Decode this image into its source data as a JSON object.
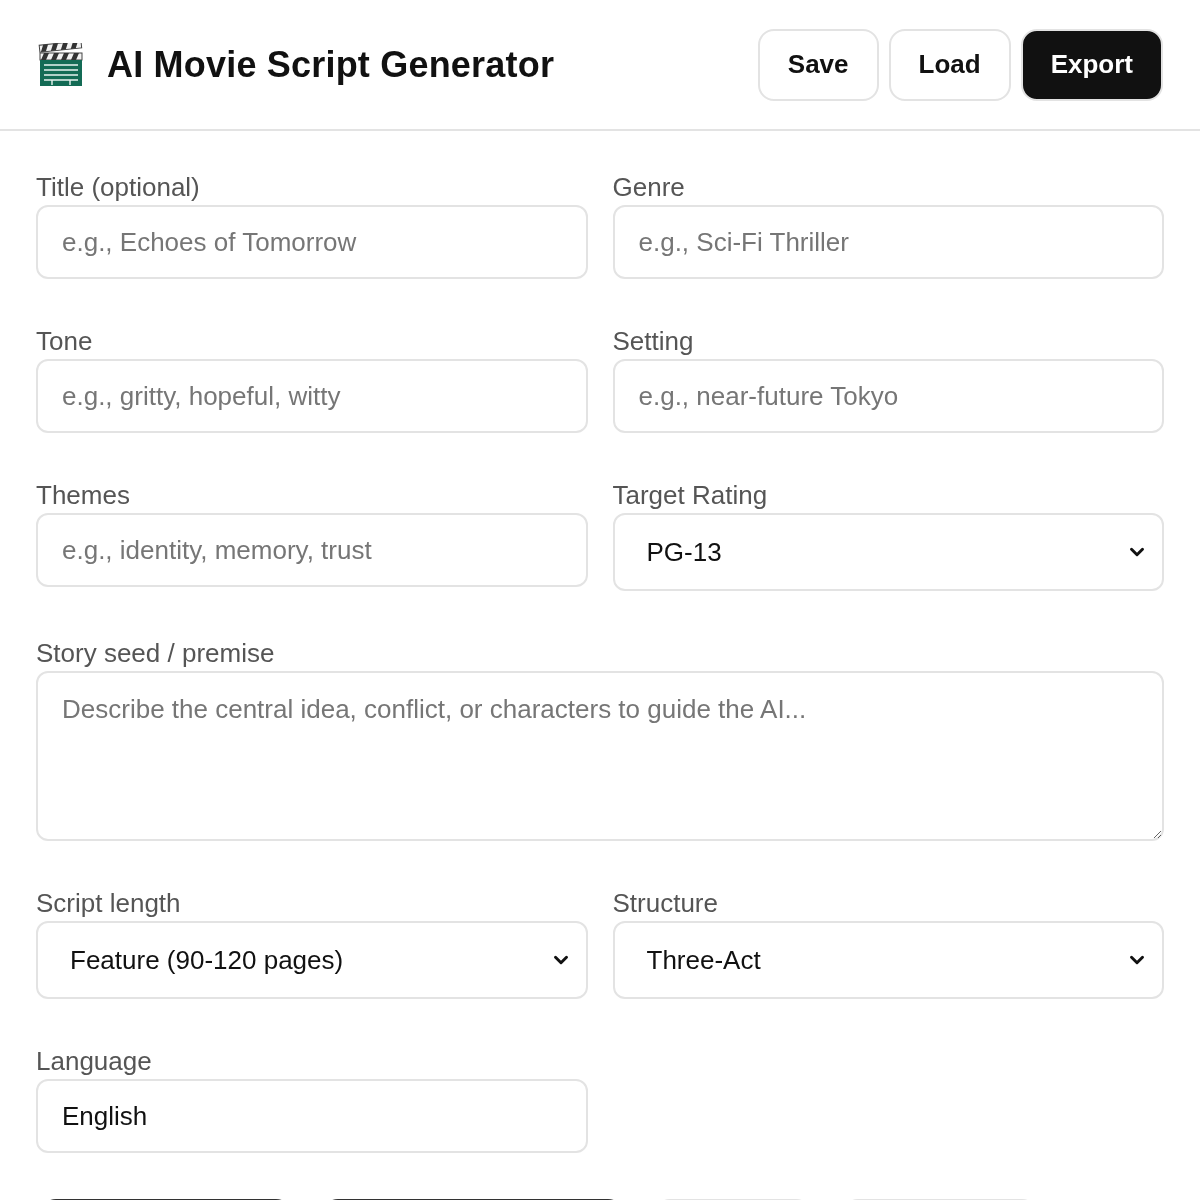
{
  "header": {
    "title": "AI Movie Script Generator",
    "buttons": [
      {
        "label": "Save",
        "kind": "secondary"
      },
      {
        "label": "Load",
        "kind": "secondary"
      },
      {
        "label": "Export",
        "kind": "primary"
      }
    ]
  },
  "fields": [
    {
      "kind": "input",
      "label": "Title (optional)",
      "placeholder": "e.g., Echoes of Tomorrow"
    },
    {
      "kind": "input",
      "label": "Genre",
      "placeholder": "e.g., Sci-Fi Thriller"
    },
    {
      "kind": "input",
      "label": "Tone",
      "placeholder": "e.g., gritty, hopeful, witty"
    },
    {
      "kind": "input",
      "label": "Setting",
      "placeholder": "e.g., near-future Tokyo"
    },
    {
      "kind": "input",
      "label": "Themes",
      "placeholder": "e.g., identity, memory, trust"
    },
    {
      "kind": "select",
      "label": "Target Rating",
      "value": "PG-13"
    },
    {
      "kind": "textarea",
      "label": "Story seed / premise",
      "placeholder": "Describe the central idea, conflict, or characters to guide the AI..."
    },
    {
      "kind": "select",
      "label": "Script length",
      "value": "Feature (90-120 pages)"
    },
    {
      "kind": "select",
      "label": "Structure",
      "value": "Three-Act"
    },
    {
      "kind": "input",
      "label": "Language",
      "value": "English"
    }
  ],
  "actions": [
    {
      "kind": "primary"
    },
    {
      "kind": "primary"
    },
    {
      "kind": "secondary"
    },
    {
      "kind": "secondary"
    }
  ]
}
